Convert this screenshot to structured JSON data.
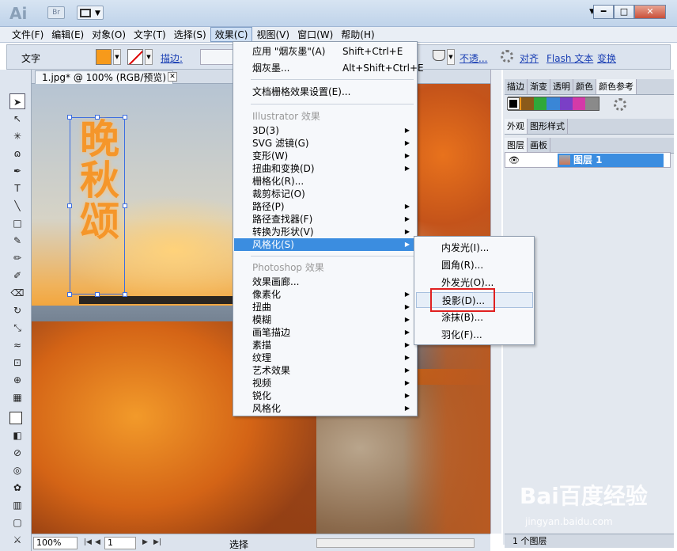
{
  "app": {
    "logo": "Ai",
    "bridge": "Br"
  },
  "window_controls": {
    "minimize": "━",
    "restore": "□",
    "close": "✕"
  },
  "menubar": [
    "文件(F)",
    "编辑(E)",
    "对象(O)",
    "文字(T)",
    "选择(S)",
    "效果(C)",
    "视图(V)",
    "窗口(W)",
    "帮助(H)"
  ],
  "menubar_active": "效果(C)",
  "control_bar": {
    "label": "文字",
    "fill_color": "#f79a1b",
    "stroke_label": "描边:",
    "opacity_label": "不透...",
    "align_label": "对齐",
    "flash_label": "Flash 文本",
    "transform_label": "变换"
  },
  "document_tab": {
    "title": "1.jpg* @ 100% (RGB/预览)",
    "close": "✕"
  },
  "canvas_text": "晚秋颂",
  "status": {
    "zoom": "100%",
    "page": "1",
    "tool": "选择"
  },
  "effects_menu": {
    "apply_last": {
      "label": "应用 \"烟灰墨\"(A)",
      "shortcut": "Shift+Ctrl+E"
    },
    "last_effect": {
      "label": "烟灰墨...",
      "shortcut": "Alt+Shift+Ctrl+E"
    },
    "raster_settings": "文档栅格效果设置(E)...",
    "illustrator_header": "Illustrator 效果",
    "illustrator_items": [
      "3D(3)",
      "SVG 滤镜(G)",
      "变形(W)",
      "扭曲和变换(D)",
      "栅格化(R)...",
      "裁剪标记(O)",
      "路径(P)",
      "路径查找器(F)",
      "转换为形状(V)",
      "风格化(S)"
    ],
    "photoshop_header": "Photoshop 效果",
    "photoshop_items": [
      "效果画廊...",
      "像素化",
      "扭曲",
      "模糊",
      "画笔描边",
      "素描",
      "纹理",
      "艺术效果",
      "视频",
      "锐化",
      "风格化"
    ],
    "highlighted": "风格化(S)"
  },
  "stylize_submenu": {
    "items": [
      "内发光(I)...",
      "圆角(R)...",
      "外发光(O)...",
      "投影(D)...",
      "涂抹(B)...",
      "羽化(F)..."
    ],
    "hovered": "投影(D)..."
  },
  "right_panel": {
    "top_tabs": [
      "描边",
      "渐变",
      "透明",
      "颜色",
      "颜色参考"
    ],
    "mid_tabs": [
      "外观",
      "图形样式"
    ],
    "layer_tabs": [
      "图层",
      "画板"
    ],
    "layer_name": "图层 1",
    "layer_count": "1 个图层"
  },
  "watermark": {
    "text": "Bai百度经验",
    "url": "jingyan.baidu.com"
  }
}
